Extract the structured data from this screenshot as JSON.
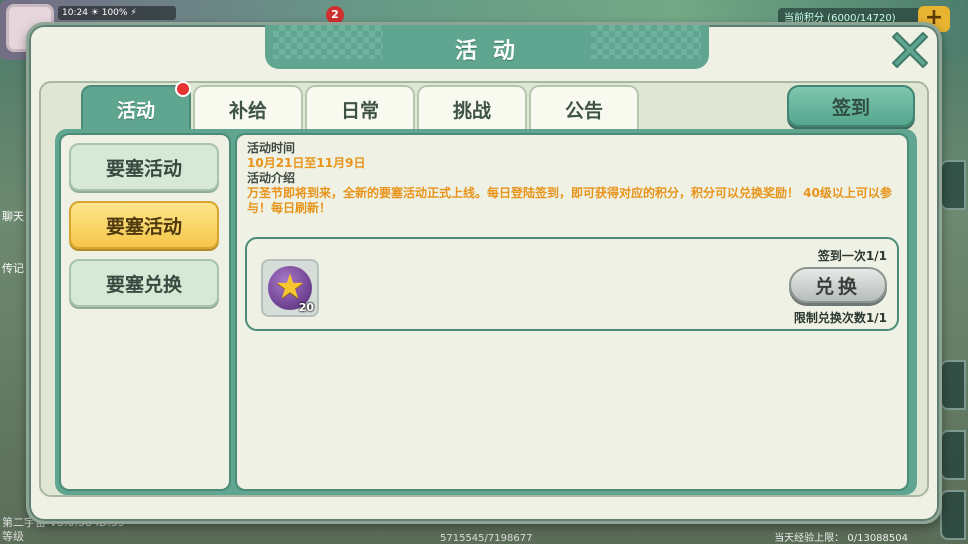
{
  "background": {
    "status_bar": "10:24 ☀ 100% ⚡",
    "coin_badge": "2",
    "top_right_text": "当前积分 (6000/14720)",
    "plus_label": "+",
    "side_chat_label": "聊天",
    "side_tip_label": "传记",
    "version_text": "第二宇宙 V3.0.58 ID:59",
    "level_text": "等级",
    "exp_text": "5715545/7198677",
    "daily_exp_text": "当天经验上限： 0/13088504"
  },
  "dialog": {
    "title": "活 动",
    "close_icon": "close-x-icon"
  },
  "tabs": [
    {
      "label": "活动",
      "active": true,
      "has_dot": true
    },
    {
      "label": "补给",
      "active": false
    },
    {
      "label": "日常",
      "active": false
    },
    {
      "label": "挑战",
      "active": false
    },
    {
      "label": "公告",
      "active": false
    }
  ],
  "signin_button": "签到",
  "categories": [
    {
      "label": "要塞活动",
      "selected": false
    },
    {
      "label": "要塞活动",
      "selected": true
    },
    {
      "label": "要塞兑换",
      "selected": false
    }
  ],
  "event": {
    "time_label": "活动时间",
    "time_value": "10月21日至11月9日",
    "intro_label": "活动介绍",
    "intro_value": "万圣节即将到来，全新的要塞活动正式上线。每日登陆签到，即可获得对应的积分，积分可以兑换奖励！ 40级以上可以参与！每日刷新！"
  },
  "reward": {
    "item_icon": "purple-star-medal-icon",
    "item_qty": "20",
    "sign_count": "签到一次1/1",
    "exchange_label": "兑换",
    "limit_count": "限制兑换次数1/1"
  },
  "colors": {
    "accent_green": "#5fa590",
    "highlight_yellow": "#f6c64a",
    "text_orange": "#e8941a",
    "alert_red": "#e53333"
  }
}
